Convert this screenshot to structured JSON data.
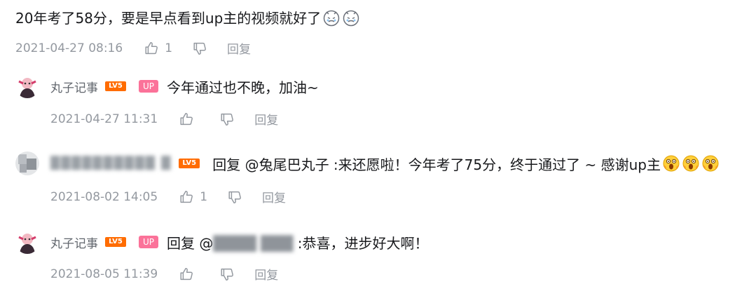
{
  "comment": {
    "text": "20年考了58分，要是早点看到up主的视频就好了",
    "emoji": [
      "face-icon",
      "face-icon"
    ],
    "time": "2021-04-27 08:16",
    "like_count": "1",
    "reply_label": "回复"
  },
  "replies": [
    {
      "name": "丸子记事",
      "level": "LV5",
      "up_badge": "UP",
      "text": "今年通过也不晚，加油~",
      "time": "2021-04-27 11:31",
      "like_count": "",
      "reply_label": "回复"
    },
    {
      "name": "",
      "level": "LV5",
      "prefix": "回复 ",
      "at_target": "@兔尾巴丸子",
      "text": " :来还愿啦！今年考了75分，终于通过了 ~ 感谢up主",
      "emoji": [
        "scream-face-icon",
        "scream-face-icon",
        "scream-face-icon"
      ],
      "time": "2021-08-02 14:05",
      "like_count": "1",
      "reply_label": "回复"
    },
    {
      "name": "丸子记事",
      "level": "LV5",
      "up_badge": "UP",
      "prefix": "回复 ",
      "at_target": "@",
      "text": " :恭喜，进步好大啊！",
      "time": "2021-08-05 11:39",
      "like_count": "",
      "reply_label": "回复"
    }
  ],
  "colors": {
    "level_badge": "#ff6c00",
    "up_badge": "#fb7299",
    "meta_text": "#9499a0"
  }
}
